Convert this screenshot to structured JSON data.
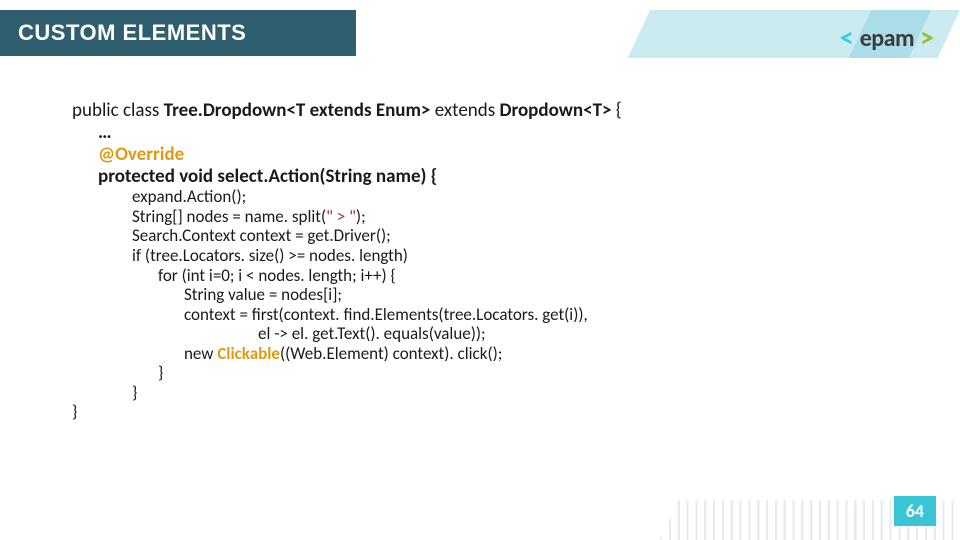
{
  "header": {
    "title": "CUSTOM ELEMENTS",
    "logo": {
      "left_bracket": "<",
      "name": "epam",
      "right_bracket": ">"
    }
  },
  "code": {
    "l01": "public class ",
    "l01b": "Tree.Dropdown<T extends Enum> ",
    "l01c": "extends ",
    "l01d": "Dropdown<T> ",
    "l01e": "{",
    "l02": "…",
    "l03": "@Override",
    "l04": "protected void select.Action(String name) {",
    "l05": "expand.Action();",
    "l06a": "String[] ",
    "l06b": "nodes = name. split(",
    "l06s": "\" > \"",
    "l06c": ");",
    "l07a": "Search.Context ",
    "l07b": "context = get.Driver();",
    "l08": "if (tree.Locators. size() >= nodes. length)",
    "l09": "for (int i=0; i < nodes. length; i++) {",
    "l10a": "String ",
    "l10b": "value = nodes[i];",
    "l11": "context = first(context. find.Elements(tree.Locators. get(i)),",
    "l12": "el -> el. get.Text(). equals(value));",
    "l13a": "new ",
    "l13b": "Clickable",
    "l13c": "((Web.Element) context). click();",
    "l14": "}",
    "l15": "}",
    "l16": "}"
  },
  "page_number": "64"
}
